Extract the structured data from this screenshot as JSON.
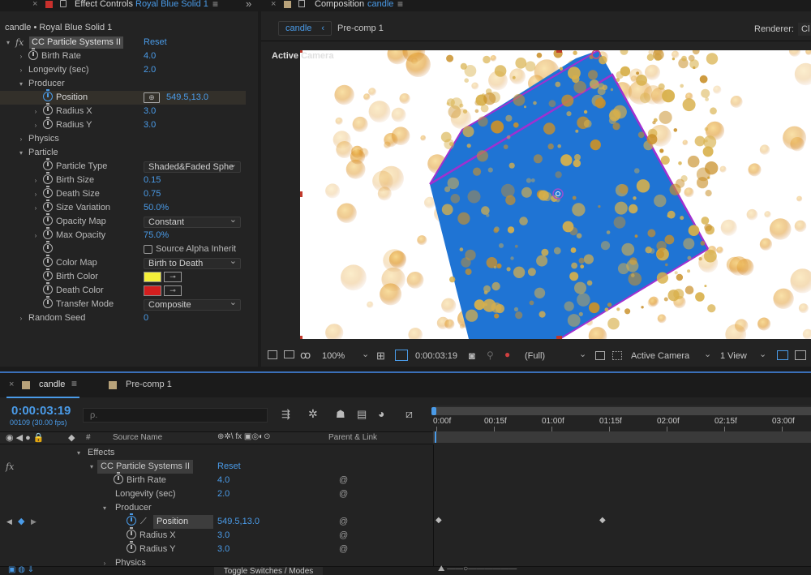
{
  "effect_controls": {
    "tab_title": "Effect Controls",
    "tab_layer": "Royal Blue Solid 1",
    "breadcrumb": "candle • Royal Blue Solid 1",
    "effect_name": "CC Particle Systems II",
    "reset_label": "Reset",
    "rows": {
      "birth_rate": {
        "label": "Birth Rate",
        "value": "4.0"
      },
      "longevity": {
        "label": "Longevity (sec)",
        "value": "2.0"
      },
      "producer": {
        "label": "Producer"
      },
      "position": {
        "label": "Position",
        "value": "549.5,13.0"
      },
      "radius_x": {
        "label": "Radius X",
        "value": "3.0"
      },
      "radius_y": {
        "label": "Radius Y",
        "value": "3.0"
      },
      "physics": {
        "label": "Physics"
      },
      "particle": {
        "label": "Particle"
      },
      "particle_type": {
        "label": "Particle Type",
        "value": "Shaded&Faded Sphe"
      },
      "birth_size": {
        "label": "Birth Size",
        "value": "0.15"
      },
      "death_size": {
        "label": "Death Size",
        "value": "0.75"
      },
      "size_variation": {
        "label": "Size Variation",
        "value": "50.0%"
      },
      "opacity_map": {
        "label": "Opacity Map",
        "value": "Constant"
      },
      "max_opacity": {
        "label": "Max Opacity",
        "value": "75.0%"
      },
      "source_alpha": {
        "label": "Source Alpha Inherit"
      },
      "color_map": {
        "label": "Color Map",
        "value": "Birth to Death"
      },
      "birth_color": {
        "label": "Birth Color",
        "color": "#f5f03a"
      },
      "death_color": {
        "label": "Death Color",
        "color": "#d41e1e"
      },
      "transfer_mode": {
        "label": "Transfer Mode",
        "value": "Composite"
      },
      "random_seed": {
        "label": "Random Seed",
        "value": "0"
      }
    }
  },
  "composition": {
    "tab_title": "Composition",
    "tab_comp": "candle",
    "flow_current": "candle",
    "flow_next": "Pre-comp 1",
    "renderer_label": "Renderer:",
    "renderer_value": "Cl",
    "active_camera_label": "Active Camera",
    "toolbar": {
      "zoom": "100%",
      "timecode": "0:00:03:19",
      "resolution": "(Full)",
      "camera": "Active Camera",
      "views": "1 View"
    }
  },
  "timeline": {
    "tab_candle": "candle",
    "tab_precomp": "Pre-comp 1",
    "timecode": "0:00:03:19",
    "frames": "00109 (30.00 fps)",
    "search_placeholder": "ρ.",
    "col_hash": "#",
    "col_source": "Source Name",
    "col_parent": "Parent & Link",
    "ruler": [
      "0:00f",
      "00:15f",
      "01:00f",
      "01:15f",
      "02:00f",
      "02:15f",
      "03:00f"
    ],
    "rows": {
      "effects": "Effects",
      "effect_name": "CC Particle Systems II",
      "reset": "Reset",
      "birth_rate": {
        "label": "Birth Rate",
        "value": "4.0"
      },
      "longevity": {
        "label": "Longevity (sec)",
        "value": "2.0"
      },
      "producer": "Producer",
      "position": {
        "label": "Position",
        "value": "549.5,13.0"
      },
      "radius_x": {
        "label": "Radius X",
        "value": "3.0"
      },
      "radius_y": {
        "label": "Radius Y",
        "value": "3.0"
      },
      "physics": "Physics"
    },
    "toggle_label": "Toggle Switches / Modes"
  },
  "colors": {
    "accent": "#4a9be8",
    "solid": "#1a6ee0",
    "particle": "#e0a020"
  }
}
